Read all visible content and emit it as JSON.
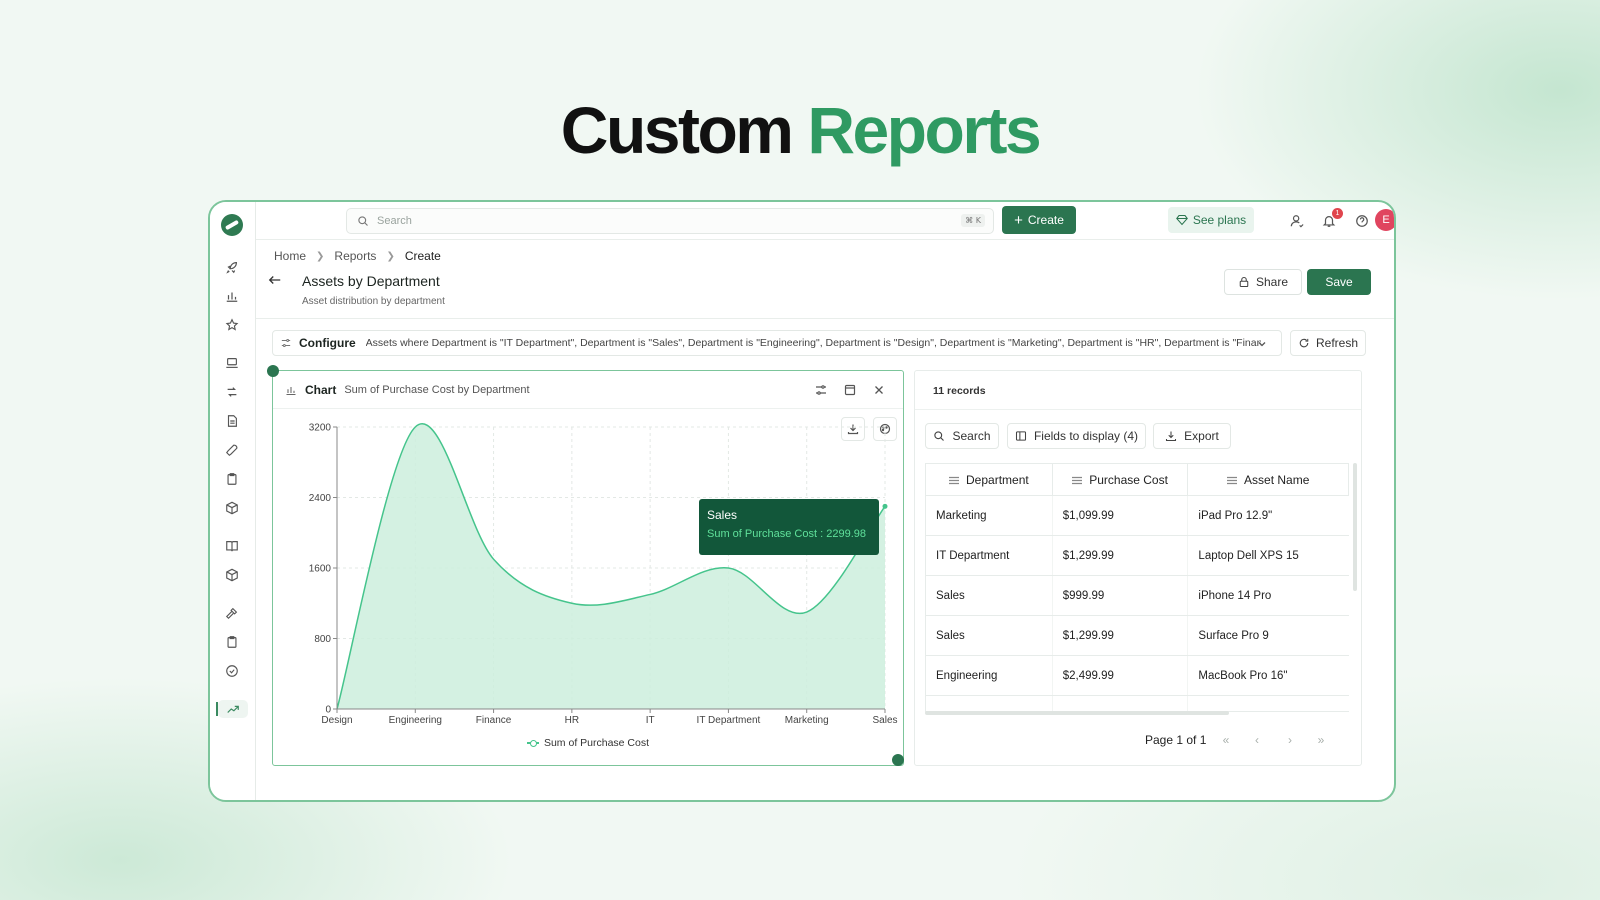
{
  "hero": {
    "word1": "Custom",
    "word2": "Reports"
  },
  "topbar": {
    "search_placeholder": "Search",
    "search_shortcut": "⌘ K",
    "create_label": "Create",
    "see_plans_label": "See plans",
    "notification_count": "1",
    "avatar_initial": "E"
  },
  "breadcrumb": {
    "items": [
      "Home",
      "Reports",
      "Create"
    ]
  },
  "report": {
    "title": "Assets by Department",
    "subtitle": "Asset distribution by department",
    "share_label": "Share",
    "save_label": "Save"
  },
  "config": {
    "label": "Configure",
    "filter_text": "Assets where Department is \"IT Department\", Department is \"Sales\", Department is \"Engineering\", Department is \"Design\", Department is \"Marketing\", Department is \"HR\", Department is \"Financ...",
    "refresh_label": "Refresh"
  },
  "chart_panel": {
    "label": "Chart",
    "title": "Sum of Purchase Cost by Department",
    "tooltip_title": "Sales",
    "tooltip_body": "Sum of Purchase Cost : 2299.98"
  },
  "chart_data": {
    "type": "area",
    "title": "Sum of Purchase Cost by Department",
    "categories": [
      "Design",
      "Engineering",
      "Finance",
      "HR",
      "IT",
      "IT Department",
      "Marketing",
      "Sales"
    ],
    "series": [
      {
        "name": "Sum of Purchase Cost",
        "values": [
          0,
          3200,
          1700,
          1200,
          1300,
          1600,
          1100,
          2300
        ]
      }
    ],
    "y_ticks": [
      0,
      800,
      1600,
      2400,
      3200
    ],
    "ylim": [
      0,
      3200
    ],
    "grid": true,
    "legend_position": "bottom",
    "line_color": "#45c48c",
    "fill_color": "#cdeedd"
  },
  "table": {
    "records_label": "11 records",
    "search_label": "Search",
    "fields_label": "Fields to display (4)",
    "export_label": "Export",
    "columns": [
      "Department",
      "Purchase Cost",
      "Asset Name"
    ],
    "rows": [
      [
        "Marketing",
        "$1,099.99",
        "iPad Pro 12.9\""
      ],
      [
        "IT Department",
        "$1,299.99",
        "Laptop Dell XPS 15"
      ],
      [
        "Sales",
        "$999.99",
        "iPhone 14 Pro"
      ],
      [
        "Sales",
        "$1,299.99",
        "Surface Pro 9"
      ],
      [
        "Engineering",
        "$2,499.99",
        "MacBook Pro 16\""
      ]
    ],
    "page_label": "Page 1 of 1"
  },
  "colors": {
    "brand": "#2b7550",
    "accent": "#2f9a62",
    "chart_line": "#45c48c"
  }
}
